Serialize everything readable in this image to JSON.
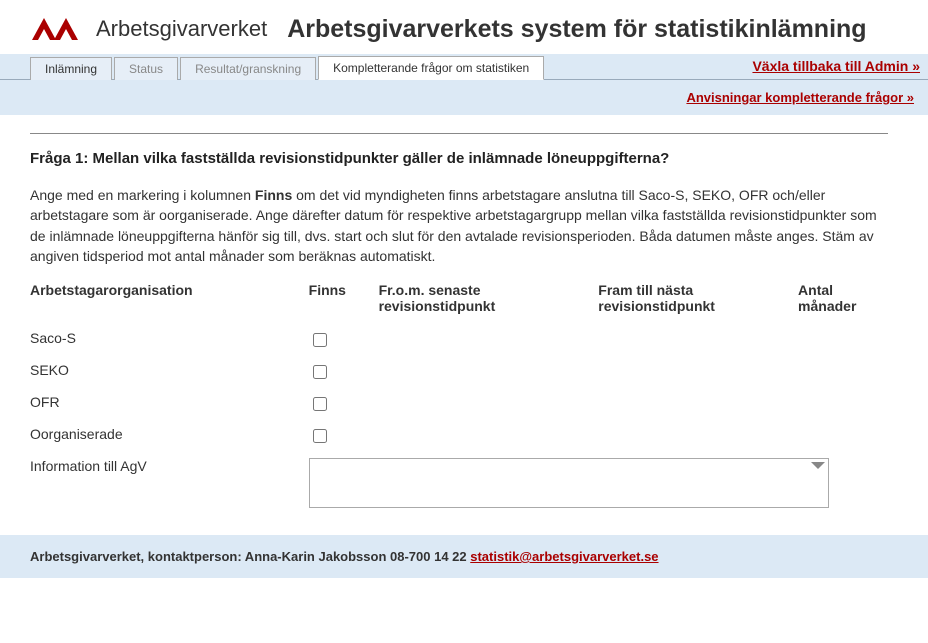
{
  "brand": "Arbetsgivarverket",
  "main_title": "Arbetsgivarverkets system för statistikinlämning",
  "tabs": [
    {
      "label": "Inlämning",
      "active": false
    },
    {
      "label": "Status",
      "active": false
    },
    {
      "label": "Resultat/granskning",
      "active": false
    },
    {
      "label": "Kompletterande frågor om statistiken",
      "active": true
    }
  ],
  "admin_link": "Växla tillbaka till Admin »",
  "instructions_link": "Anvisningar kompletterande frågor »",
  "question": {
    "title": "Fråga 1: Mellan vilka fastställda revisionstidpunkter gäller de inlämnade löneuppgifterna?",
    "intro_before": "Ange med en markering i kolumnen ",
    "intro_bold": "Finns",
    "intro_after": " om det vid myndigheten finns arbetstagare anslutna till Saco-S, SEKO, OFR och/eller arbetstagare som är oorganiserade. Ange därefter datum för respektive arbetstagargrupp mellan vilka fastställda revisionstidpunkter som de inlämnade löneuppgifterna hänför sig till, dvs. start och slut för den avtalade revisionsperioden. Båda datumen måste anges. Stäm av angiven tidsperiod mot antal månader som beräknas automatiskt."
  },
  "columns": {
    "org": "Arbetstagarorganisation",
    "finns": "Finns",
    "from": "Fr.o.m. senaste revisionstidpunkt",
    "till": "Fram till nästa revisionstidpunkt",
    "antal": "Antal månader"
  },
  "rows": [
    {
      "name": "Saco-S"
    },
    {
      "name": "SEKO"
    },
    {
      "name": "OFR"
    },
    {
      "name": "Oorganiserade"
    }
  ],
  "info_label": "Information till AgV",
  "footer": {
    "text": "Arbetsgivarverket, kontaktperson: Anna-Karin Jakobsson 08-700 14 22 ",
    "email": "statistik@arbetsgivarverket.se"
  }
}
